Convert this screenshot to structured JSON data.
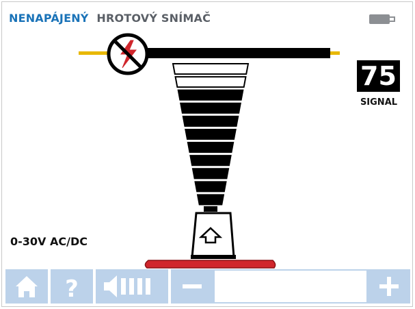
{
  "header": {
    "mode_text": "NENAPÁJENÝ",
    "probe_text": "HROTOVÝ SNÍMAČ"
  },
  "signal": {
    "value": "75",
    "label": "SIGNAL"
  },
  "voltage_range": "0-30V AC/DC",
  "battery": {
    "icon": "battery-icon"
  },
  "signal_bars": {
    "outlined": 2,
    "filled": 9
  },
  "colors": {
    "accent_blue": "#1a73b8",
    "toolbar_blue": "#bcd2ea",
    "probe_red": "#d0262c",
    "wire_yellow": "#e8b800"
  },
  "toolbar": {
    "home_icon": "home-icon",
    "help_icon": "help-icon",
    "volume_icon": "volume-icon",
    "decrease_icon": "minus-icon",
    "increase_icon": "plus-icon",
    "volume_level": 0
  }
}
